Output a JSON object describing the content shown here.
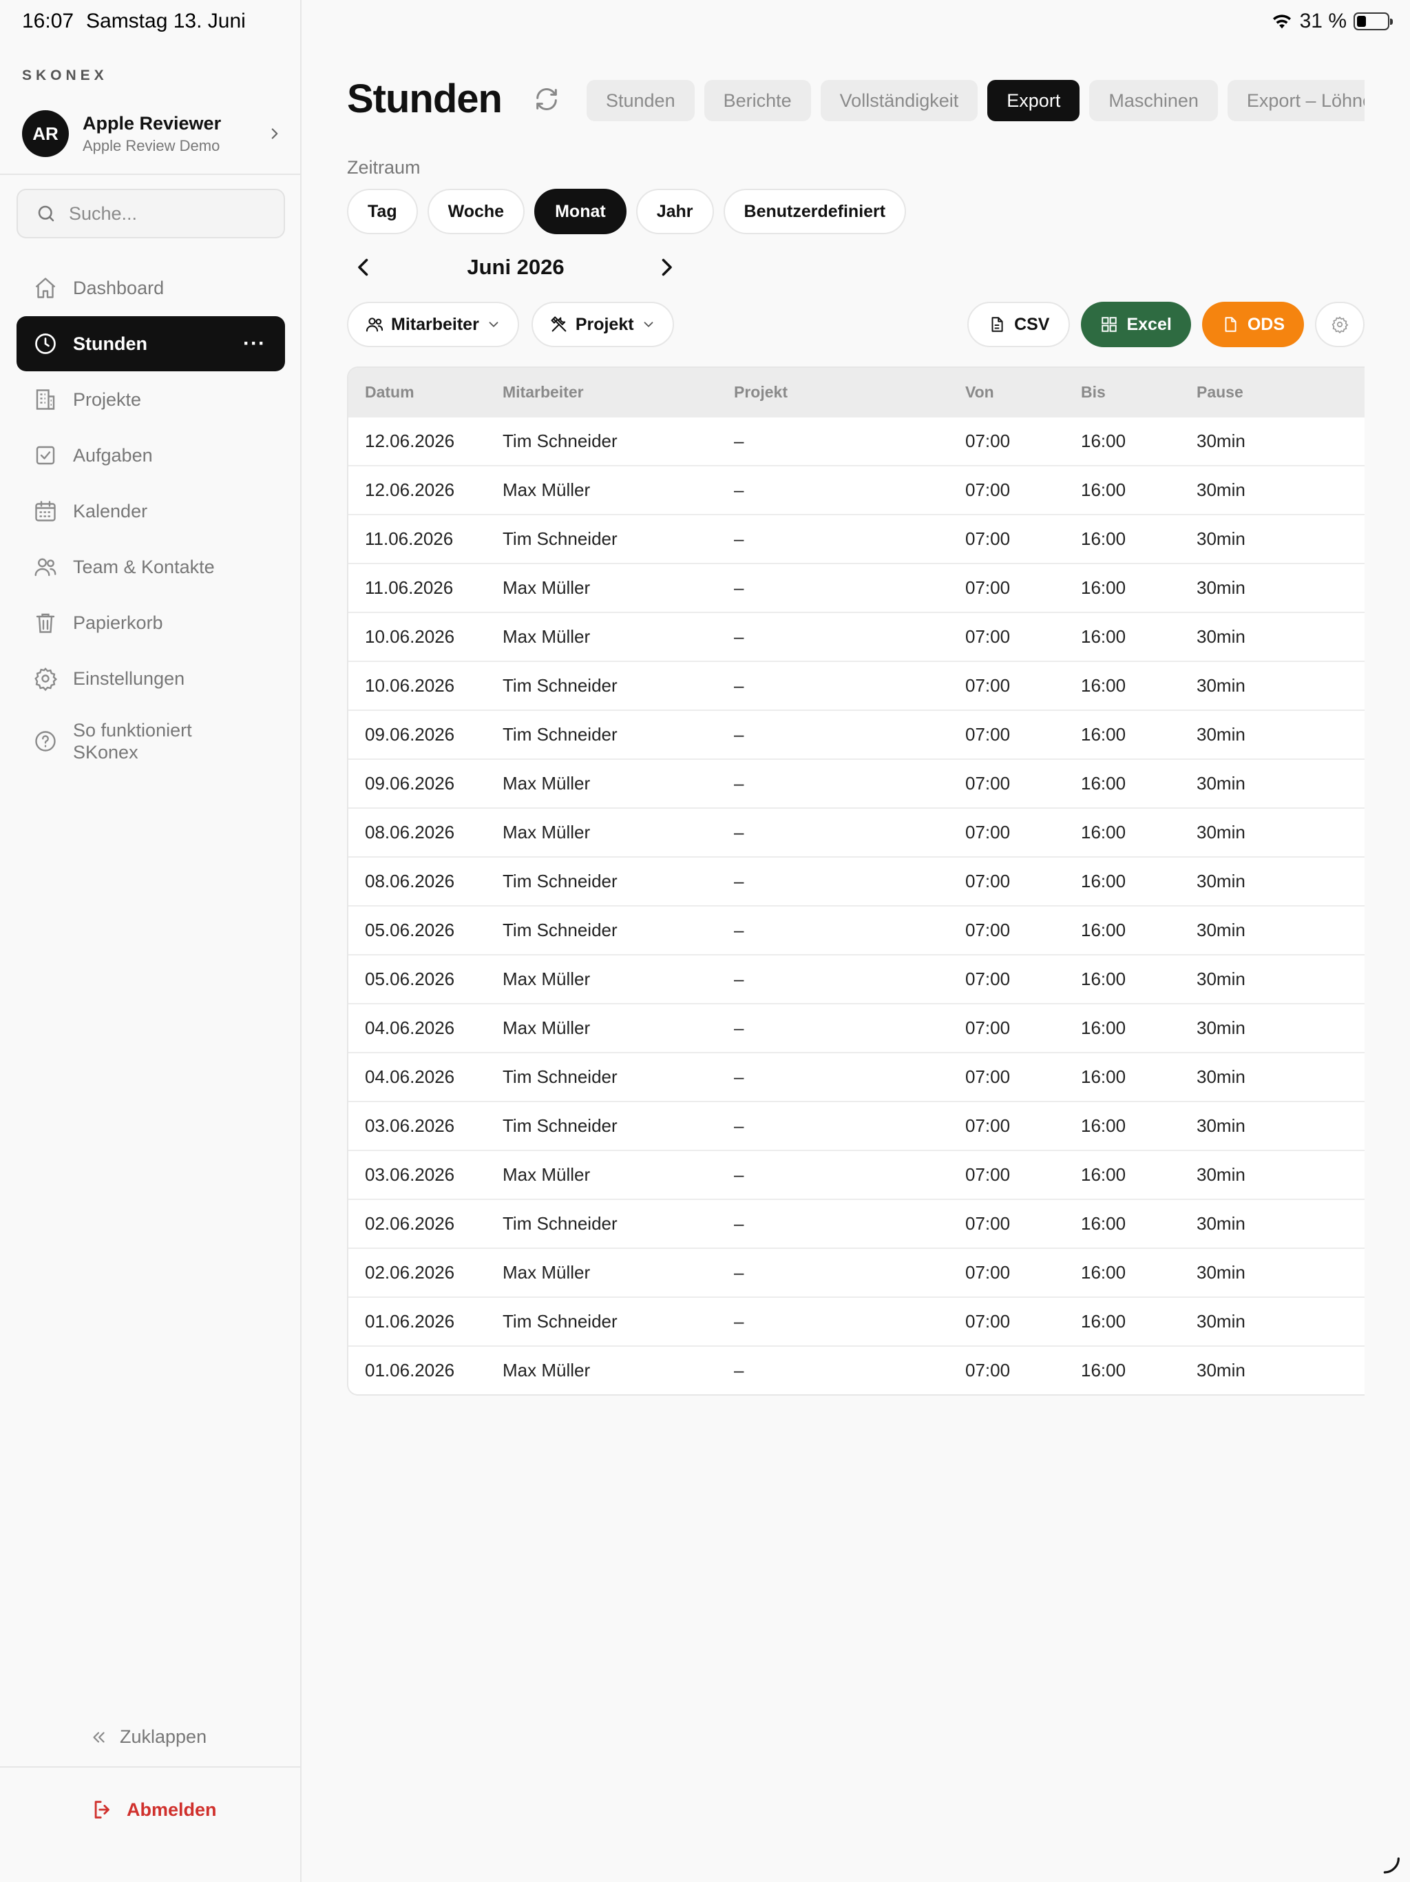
{
  "status_bar": {
    "time": "16:07",
    "date": "Samstag 13. Juni",
    "battery": "31 %",
    "battery_level": 0.31
  },
  "sidebar": {
    "brand": "SKONEX",
    "account": {
      "initials": "AR",
      "name": "Apple Reviewer",
      "subtitle": "Apple Review Demo"
    },
    "search_placeholder": "Suche...",
    "items": [
      {
        "label": "Dashboard",
        "icon": "home-icon"
      },
      {
        "label": "Stunden",
        "icon": "clock-icon",
        "active": true
      },
      {
        "label": "Projekte",
        "icon": "building-icon"
      },
      {
        "label": "Aufgaben",
        "icon": "checkbox-icon"
      },
      {
        "label": "Kalender",
        "icon": "calendar-icon"
      },
      {
        "label": "Team & Kontakte",
        "icon": "users-icon"
      },
      {
        "label": "Papierkorb",
        "icon": "trash-icon"
      },
      {
        "label": "Einstellungen",
        "icon": "gear-icon"
      },
      {
        "label": "So funktioniert SKonex",
        "icon": "help-icon"
      }
    ],
    "more": "···",
    "collapse_label": "Zuklappen",
    "logout_label": "Abmelden"
  },
  "header": {
    "title": "Stunden",
    "tabs": [
      {
        "label": "Stunden"
      },
      {
        "label": "Berichte"
      },
      {
        "label": "Vollständigkeit"
      },
      {
        "label": "Export",
        "active": true
      },
      {
        "label": "Maschinen"
      },
      {
        "label": "Export – Löhne"
      }
    ]
  },
  "period": {
    "label": "Zeitraum",
    "options": [
      {
        "label": "Tag"
      },
      {
        "label": "Woche"
      },
      {
        "label": "Monat",
        "active": true
      },
      {
        "label": "Jahr"
      },
      {
        "label": "Benutzerdefiniert"
      }
    ],
    "current": "Juni 2026"
  },
  "filters": {
    "employee": "Mitarbeiter",
    "project": "Projekt"
  },
  "export_buttons": {
    "csv": "CSV",
    "excel": "Excel",
    "ods": "ODS"
  },
  "colors": {
    "excel": "#2e6b41",
    "ods": "#f5840f",
    "logout": "#d0312d",
    "active": "#111111"
  },
  "table": {
    "columns": [
      "Datum",
      "Mitarbeiter",
      "Projekt",
      "Von",
      "Bis",
      "Pause"
    ],
    "rows": [
      [
        "12.06.2026",
        "Tim Schneider",
        "–",
        "07:00",
        "16:00",
        "30min"
      ],
      [
        "12.06.2026",
        "Max Müller",
        "–",
        "07:00",
        "16:00",
        "30min"
      ],
      [
        "11.06.2026",
        "Tim Schneider",
        "–",
        "07:00",
        "16:00",
        "30min"
      ],
      [
        "11.06.2026",
        "Max Müller",
        "–",
        "07:00",
        "16:00",
        "30min"
      ],
      [
        "10.06.2026",
        "Max Müller",
        "–",
        "07:00",
        "16:00",
        "30min"
      ],
      [
        "10.06.2026",
        "Tim Schneider",
        "–",
        "07:00",
        "16:00",
        "30min"
      ],
      [
        "09.06.2026",
        "Tim Schneider",
        "–",
        "07:00",
        "16:00",
        "30min"
      ],
      [
        "09.06.2026",
        "Max Müller",
        "–",
        "07:00",
        "16:00",
        "30min"
      ],
      [
        "08.06.2026",
        "Max Müller",
        "–",
        "07:00",
        "16:00",
        "30min"
      ],
      [
        "08.06.2026",
        "Tim Schneider",
        "–",
        "07:00",
        "16:00",
        "30min"
      ],
      [
        "05.06.2026",
        "Tim Schneider",
        "–",
        "07:00",
        "16:00",
        "30min"
      ],
      [
        "05.06.2026",
        "Max Müller",
        "–",
        "07:00",
        "16:00",
        "30min"
      ],
      [
        "04.06.2026",
        "Max Müller",
        "–",
        "07:00",
        "16:00",
        "30min"
      ],
      [
        "04.06.2026",
        "Tim Schneider",
        "–",
        "07:00",
        "16:00",
        "30min"
      ],
      [
        "03.06.2026",
        "Tim Schneider",
        "–",
        "07:00",
        "16:00",
        "30min"
      ],
      [
        "03.06.2026",
        "Max Müller",
        "–",
        "07:00",
        "16:00",
        "30min"
      ],
      [
        "02.06.2026",
        "Tim Schneider",
        "–",
        "07:00",
        "16:00",
        "30min"
      ],
      [
        "02.06.2026",
        "Max Müller",
        "–",
        "07:00",
        "16:00",
        "30min"
      ],
      [
        "01.06.2026",
        "Tim Schneider",
        "–",
        "07:00",
        "16:00",
        "30min"
      ],
      [
        "01.06.2026",
        "Max Müller",
        "–",
        "07:00",
        "16:00",
        "30min"
      ]
    ]
  }
}
